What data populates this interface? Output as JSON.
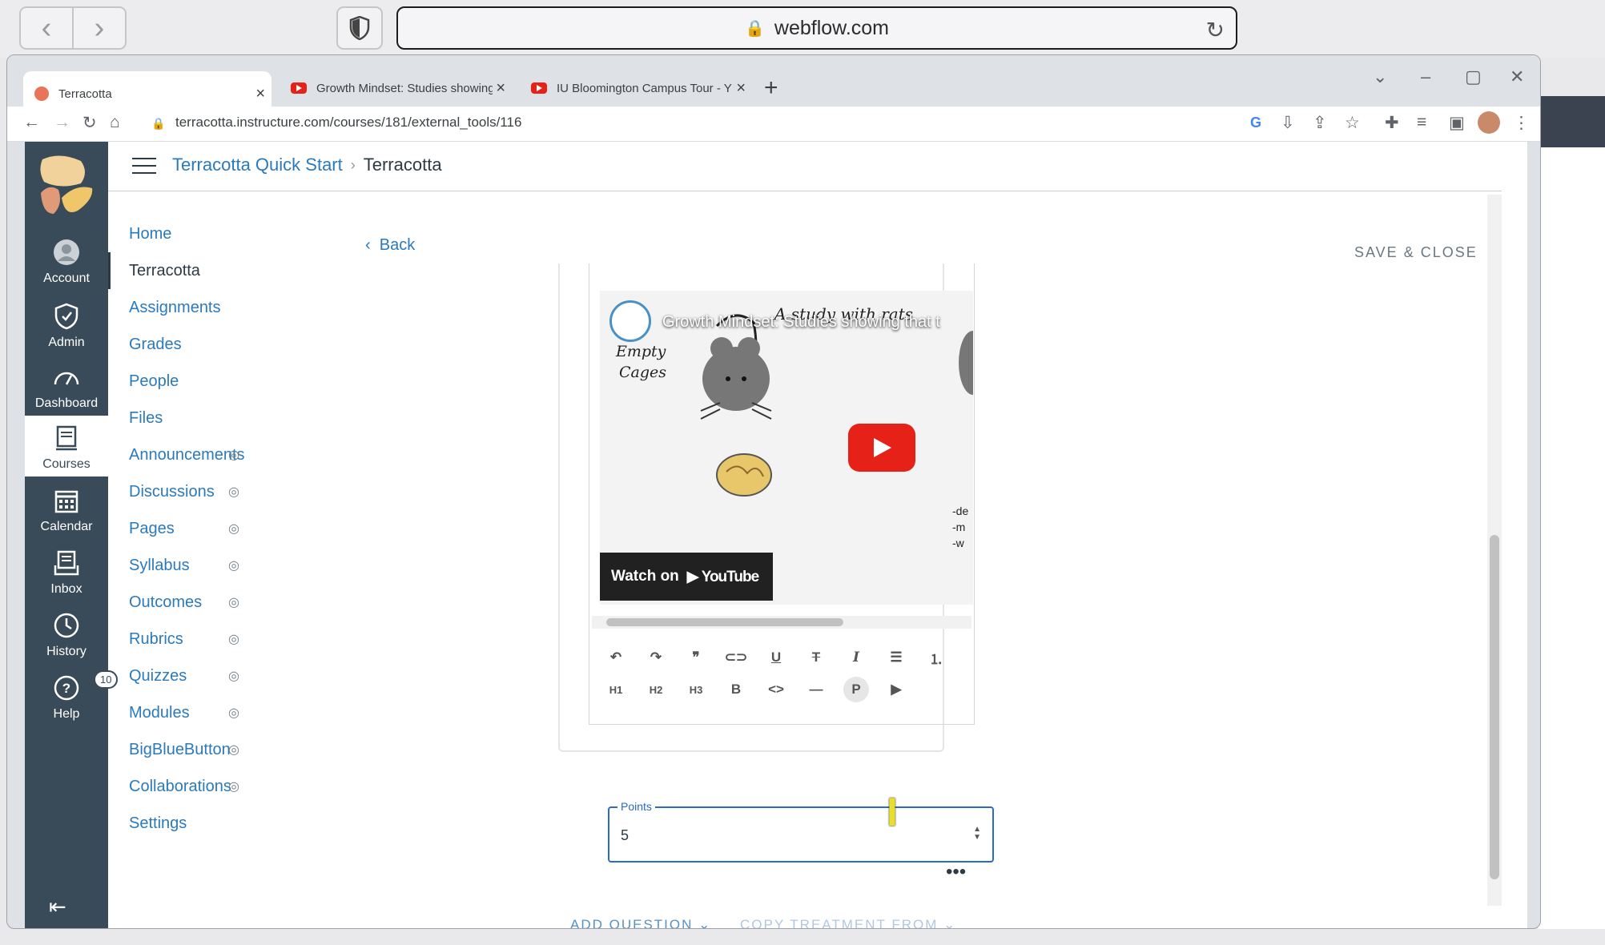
{
  "safari": {
    "url": "webflow.com"
  },
  "tabs": [
    {
      "title": "Terracotta",
      "active": true
    },
    {
      "title": "Growth Mindset: Studies showing"
    },
    {
      "title": "IU Bloomington Campus Tour - Y"
    }
  ],
  "address": "terracotta.instructure.com/courses/181/external_tools/116",
  "global_nav": [
    {
      "label": "Account",
      "icon": "account-icon"
    },
    {
      "label": "Admin",
      "icon": "admin-icon"
    },
    {
      "label": "Dashboard",
      "icon": "dashboard-icon"
    },
    {
      "label": "Courses",
      "icon": "courses-icon",
      "active": true
    },
    {
      "label": "Calendar",
      "icon": "calendar-icon"
    },
    {
      "label": "Inbox",
      "icon": "inbox-icon"
    },
    {
      "label": "History",
      "icon": "history-icon"
    },
    {
      "label": "Help",
      "icon": "help-icon",
      "badge": "10"
    }
  ],
  "breadcrumb": {
    "course": "Terracotta Quick Start",
    "current": "Terracotta"
  },
  "course_nav": [
    {
      "label": "Home"
    },
    {
      "label": "Terracotta",
      "active": true
    },
    {
      "label": "Assignments"
    },
    {
      "label": "Grades"
    },
    {
      "label": "People"
    },
    {
      "label": "Files"
    },
    {
      "label": "Announcements",
      "hidden": true
    },
    {
      "label": "Discussions",
      "hidden": true
    },
    {
      "label": "Pages",
      "hidden": true
    },
    {
      "label": "Syllabus",
      "hidden": true
    },
    {
      "label": "Outcomes",
      "hidden": true
    },
    {
      "label": "Rubrics",
      "hidden": true
    },
    {
      "label": "Quizzes",
      "hidden": true
    },
    {
      "label": "Modules",
      "hidden": true
    },
    {
      "label": "BigBlueButton",
      "hidden": true
    },
    {
      "label": "Collaborations",
      "hidden": true
    },
    {
      "label": "Settings"
    }
  ],
  "back_label": "Back",
  "save_close": "SAVE & CLOSE",
  "video": {
    "title": "Growth Mindset: Studies showing that t",
    "watch_on": "Watch on",
    "brand": "YouTube"
  },
  "toolbar": {
    "row2": [
      "H1",
      "H2",
      "H3"
    ]
  },
  "points": {
    "label": "Points",
    "value": "5"
  },
  "actions": {
    "add_question": "ADD QUESTION",
    "copy_treatment": "COPY TREATMENT FROM"
  }
}
